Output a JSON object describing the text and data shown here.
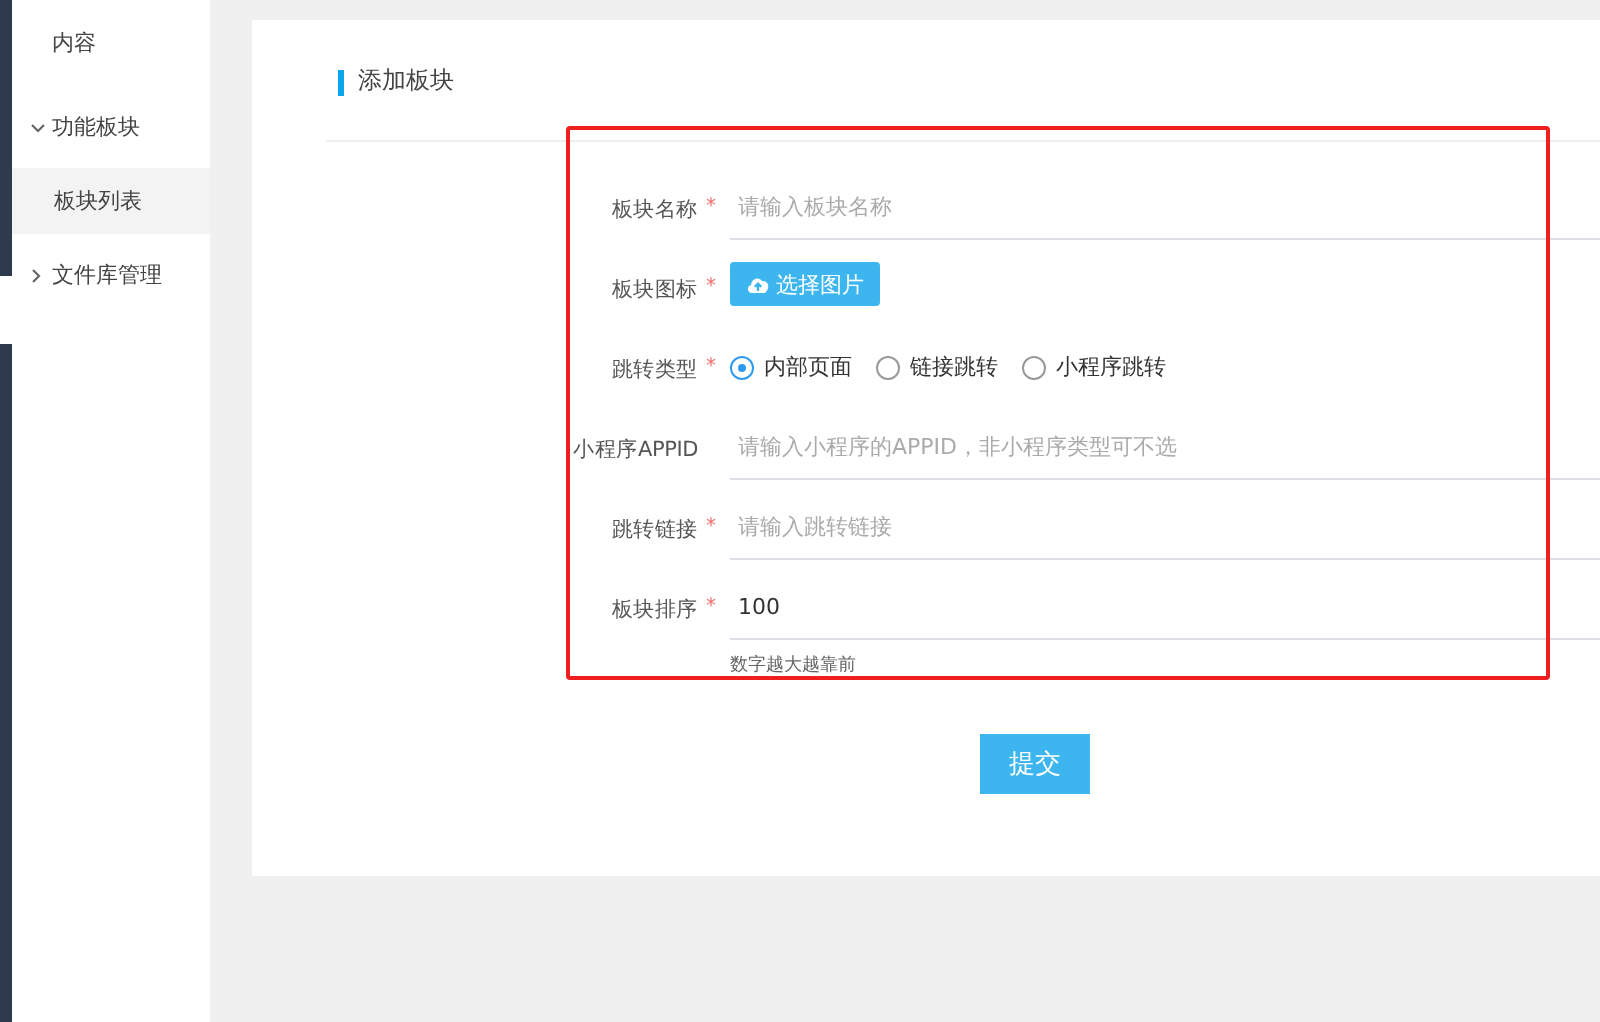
{
  "sidebar": {
    "items": [
      {
        "label": "内容"
      },
      {
        "label": "功能板块",
        "expanded": true,
        "children": [
          {
            "label": "板块列表",
            "selected": true
          }
        ]
      },
      {
        "label": "文件库管理",
        "expanded": false
      }
    ]
  },
  "card": {
    "title": "添加板块",
    "fields": [
      {
        "kind": "text",
        "label": "板块名称",
        "mark": "*",
        "placeholder": "请输入板块名称"
      },
      {
        "kind": "upload",
        "label": "板块图标",
        "mark": "*",
        "button": "选择图片"
      },
      {
        "kind": "radio",
        "label": "跳转类型",
        "mark": "*",
        "options": [
          {
            "label": "内部页面",
            "selected": true
          },
          {
            "label": "链接跳转",
            "selected": false
          },
          {
            "label": "小程序跳转",
            "selected": false
          }
        ]
      },
      {
        "kind": "text",
        "label": "小程序APPID",
        "placeholder": "请输入小程序的APPID，非小程序类型可不选"
      },
      {
        "kind": "text",
        "label": "跳转链接",
        "mark": "*",
        "placeholder": "请输入跳转链接"
      },
      {
        "kind": "text",
        "label": "板块排序",
        "mark": "*",
        "value": "100",
        "hint": "数字越大越靠前"
      }
    ],
    "submit": "提交"
  }
}
